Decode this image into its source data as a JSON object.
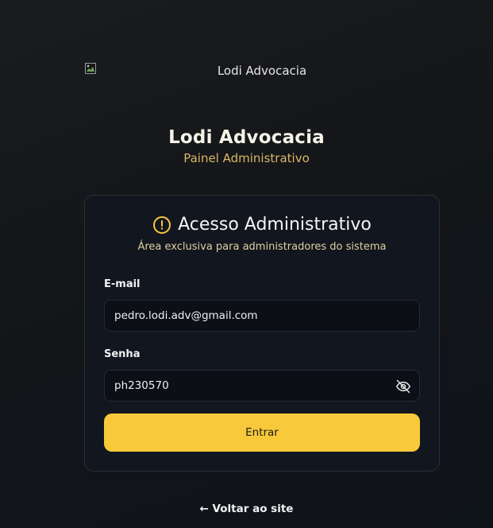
{
  "logo": {
    "alt": "Lodi Advocacia",
    "icon": "broken-image-icon"
  },
  "brand": {
    "title": "Lodi Advocacia",
    "subtitle": "Painel Administrativo"
  },
  "card": {
    "title": "Acesso Administrativo",
    "subtitle": "Área exclusiva para administradores do sistema",
    "icon": "alert-circle-icon"
  },
  "form": {
    "email_label": "E-mail",
    "email_value": "pedro.lodi.adv@gmail.com",
    "password_label": "Senha",
    "password_value": "ph230570",
    "toggle_icon": "eye-off-icon",
    "submit_label": "Entrar"
  },
  "footer": {
    "back_link": "← Voltar ao site"
  },
  "colors": {
    "accent": "#f8c93a",
    "card_bg": "#12161f",
    "subtitle_gold": "#d9b866"
  }
}
